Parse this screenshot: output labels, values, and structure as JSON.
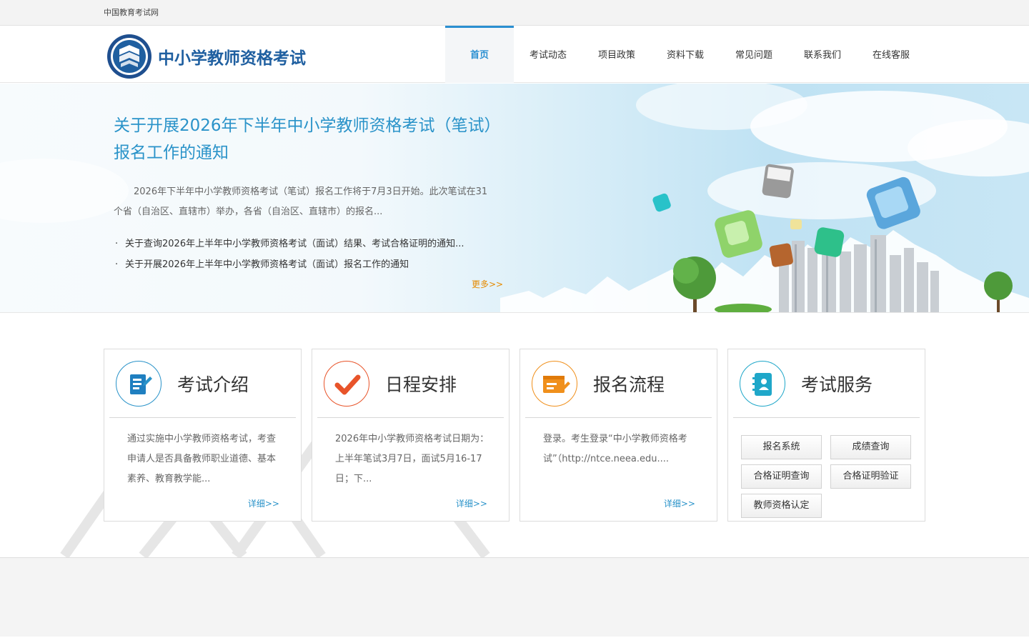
{
  "topbar": {
    "site_link": "中国教育考试网"
  },
  "header": {
    "logo_title": "中小学教师资格考试",
    "nav": [
      {
        "label": "首页",
        "active": true
      },
      {
        "label": "考试动态"
      },
      {
        "label": "项目政策"
      },
      {
        "label": "资料下载"
      },
      {
        "label": "常见问题"
      },
      {
        "label": "联系我们"
      },
      {
        "label": "在线客服"
      }
    ]
  },
  "banner": {
    "title": "关于开展2026年下半年中小学教师资格考试（笔试）报名工作的通知",
    "desc": "2026年下半年中小学教师资格考试（笔试）报名工作将于7月3日开始。此次笔试在31个省（自治区、直辖市）举办，各省（自治区、直辖市）的报名...",
    "bullet": "·",
    "list": [
      "关于查询2026年上半年中小学教师资格考试（面试）结果、考试合格证明的通知...",
      "关于开展2026年上半年中小学教师资格考试（面试）报名工作的通知"
    ],
    "more": "更多>>"
  },
  "cards": [
    {
      "title": "考试介绍",
      "icon": "document-edit-icon",
      "color": "#2a93c9",
      "text": "通过实施中小学教师资格考试，考查申请人是否具备教师职业道德、基本素养、教育教学能...",
      "detail": "详细>>"
    },
    {
      "title": "日程安排",
      "icon": "checkmark-icon",
      "color": "#e8542a",
      "text": "2026年中小学教师资格考试日期为：上半年笔试3月7日，面试5月16-17日；下...",
      "detail": "详细>>"
    },
    {
      "title": "报名流程",
      "icon": "signup-form-icon",
      "color": "#f0901c",
      "text": "登录。考生登录“中小学教师资格考试”（http://ntce.neea.edu....",
      "detail": "详细>>"
    },
    {
      "title": "考试服务",
      "icon": "contact-book-icon",
      "color": "#1fa7c9",
      "services": [
        "报名系统",
        "成绩查询",
        "合格证明查询",
        "合格证明验证",
        "教师资格认定"
      ]
    }
  ]
}
